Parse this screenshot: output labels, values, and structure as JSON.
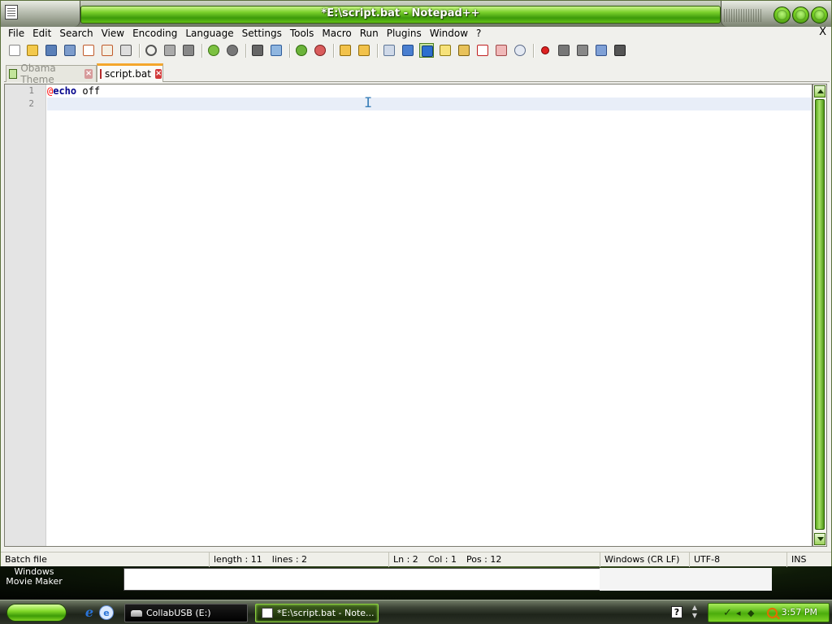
{
  "window": {
    "title": "*E:\\script.bat - Notepad++",
    "doc_close": "X"
  },
  "menu": [
    {
      "label": "File"
    },
    {
      "label": "Edit"
    },
    {
      "label": "Search"
    },
    {
      "label": "View"
    },
    {
      "label": "Encoding"
    },
    {
      "label": "Language"
    },
    {
      "label": "Settings"
    },
    {
      "label": "Tools"
    },
    {
      "label": "Macro"
    },
    {
      "label": "Run"
    },
    {
      "label": "Plugins"
    },
    {
      "label": "Window"
    },
    {
      "label": "?"
    }
  ],
  "toolbar": {
    "icons": [
      "new-file-icon",
      "open-file-icon",
      "save-icon",
      "save-all-icon",
      "close-icon",
      "close-all-icon",
      "print-icon",
      "cut-icon",
      "copy-icon",
      "paste-icon",
      "undo-icon",
      "redo-icon",
      "find-icon",
      "replace-icon",
      "zoom-in-icon",
      "zoom-out-icon",
      "sync-vertical-icon",
      "sync-horizontal-icon",
      "word-wrap-icon",
      "show-all-chars-icon",
      "indent-guide-icon",
      "user-lang-icon",
      "doc-map-icon",
      "function-list-icon",
      "folder-workspace-icon",
      "monitor-icon",
      "record-macro-icon",
      "stop-macro-icon",
      "play-macro-icon",
      "run-macro-multiple-icon",
      "save-macro-icon"
    ]
  },
  "tabs": [
    {
      "label": "Obama Theme",
      "active": false
    },
    {
      "label": "script.bat",
      "active": true
    }
  ],
  "editor": {
    "line_numbers": [
      "1",
      "2"
    ],
    "line1": {
      "at": "@",
      "keyword": "echo",
      "rest": " off"
    },
    "line2": ""
  },
  "status": {
    "type": "Batch file",
    "length": "length : 11",
    "lines": "lines : 2",
    "ln": "Ln : 2",
    "col": "Col : 1",
    "pos": "Pos : 12",
    "eol": "Windows (CR LF)",
    "encoding": "UTF-8",
    "mode": "INS"
  },
  "desktop": {
    "label": "Windows Movie Maker"
  },
  "taskbar": {
    "tasks": [
      {
        "label": "CollabUSB (E:)"
      },
      {
        "label": "*E:\\script.bat - Note..."
      }
    ],
    "help": "?",
    "clock": "3:57 PM"
  },
  "colors": {
    "accent_green": "#7bd12c",
    "active_tab_border": "#f4a62c",
    "keyword_blue": "#00008b",
    "at_red": "#ff0000",
    "current_line": "#e8eef8"
  }
}
